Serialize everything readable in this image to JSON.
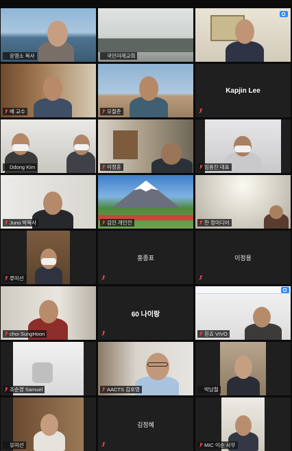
{
  "participants": [
    {
      "name": "윤영소 목사",
      "muted": false
    },
    {
      "name": "국민미래교회",
      "muted": false
    },
    {
      "name": "",
      "muted": false
    },
    {
      "name": "배 교수",
      "muted": true
    },
    {
      "name": "오철준",
      "muted": true
    },
    {
      "name": "Kapjin Lee",
      "muted": true
    },
    {
      "name": "Ddong Kim",
      "muted": false
    },
    {
      "name": "이정훈",
      "muted": true
    },
    {
      "name": "임용진 대표",
      "muted": true
    },
    {
      "name": "Juno 박목사",
      "muted": true
    },
    {
      "name": "김인 개인전",
      "muted": true
    },
    {
      "name": "한 정미디어",
      "muted": true
    },
    {
      "name": "류미선",
      "muted": true
    },
    {
      "name": "홍종표",
      "muted": true
    },
    {
      "name": "이정용",
      "muted": true
    },
    {
      "name": "choi SungHoon",
      "muted": true
    },
    {
      "name": "60 나이랑",
      "muted": true
    },
    {
      "name": "흰죠 VIVO",
      "muted": true
    },
    {
      "name": "조순경 Samuel",
      "muted": true
    },
    {
      "name": "AACTS 김호영",
      "muted": true
    },
    {
      "name": "박남철",
      "muted": false
    },
    {
      "name": "유미선",
      "muted": false
    },
    {
      "name": "김정혜",
      "muted": true
    },
    {
      "name": "MIC 이순 사무",
      "muted": true
    }
  ]
}
